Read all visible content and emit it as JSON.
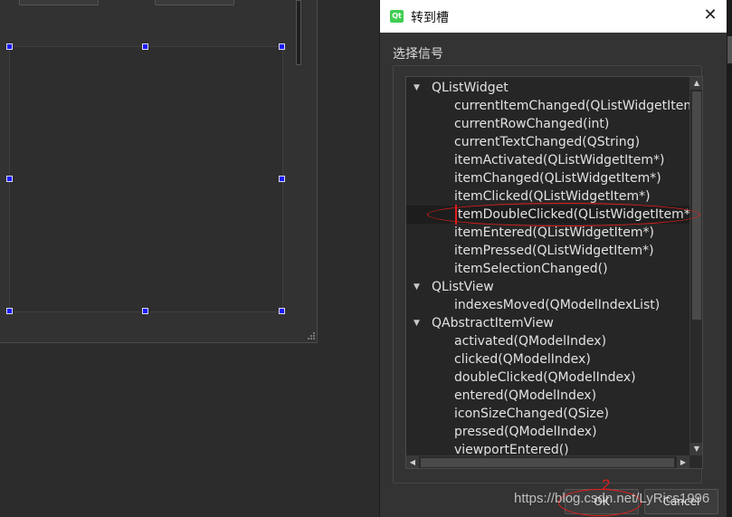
{
  "dialog": {
    "title": "转到槽",
    "logo_text": "Qt",
    "close_glyph": "✕",
    "section_label": "选择信号",
    "ok_label": "OK",
    "cancel_label": "Cancel"
  },
  "tree": {
    "rows": [
      {
        "text": "QListWidget",
        "parent": true
      },
      {
        "text": "currentItemChanged(QListWidgetItem*,QListWidgetItem*)",
        "parent": false
      },
      {
        "text": "currentRowChanged(int)",
        "parent": false
      },
      {
        "text": "currentTextChanged(QString)",
        "parent": false
      },
      {
        "text": "itemActivated(QListWidgetItem*)",
        "parent": false
      },
      {
        "text": "itemChanged(QListWidgetItem*)",
        "parent": false
      },
      {
        "text": "itemClicked(QListWidgetItem*)",
        "parent": false
      },
      {
        "text": "itemDoubleClicked(QListWidgetItem*)",
        "parent": false,
        "selected": true
      },
      {
        "text": "itemEntered(QListWidgetItem*)",
        "parent": false
      },
      {
        "text": "itemPressed(QListWidgetItem*)",
        "parent": false
      },
      {
        "text": "itemSelectionChanged()",
        "parent": false
      },
      {
        "text": "QListView",
        "parent": true
      },
      {
        "text": "indexesMoved(QModelIndexList)",
        "parent": false
      },
      {
        "text": "QAbstractItemView",
        "parent": true
      },
      {
        "text": "activated(QModelIndex)",
        "parent": false
      },
      {
        "text": "clicked(QModelIndex)",
        "parent": false
      },
      {
        "text": "doubleClicked(QModelIndex)",
        "parent": false
      },
      {
        "text": "entered(QModelIndex)",
        "parent": false
      },
      {
        "text": "iconSizeChanged(QSize)",
        "parent": false
      },
      {
        "text": "pressed(QModelIndex)",
        "parent": false
      },
      {
        "text": "viewportEntered()",
        "parent": false
      }
    ]
  },
  "annotations": {
    "step_number": "2",
    "ellipse_color": "#e01e1e"
  },
  "watermark": "https://blog.csdn.net/LyRics1996",
  "icons": {
    "expanded": "▼",
    "scroll_up": "▲",
    "scroll_down": "▼",
    "scroll_left": "◀",
    "scroll_right": "▶"
  }
}
